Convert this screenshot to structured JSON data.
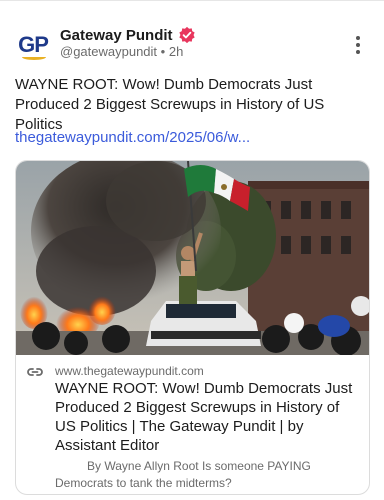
{
  "post": {
    "author_name": "Gateway Pundit",
    "handle": "@gatewaypundit",
    "separator": "•",
    "time": "2h",
    "avatar_initials": "GP",
    "verified_color": "#e8365d",
    "text": "WAYNE ROOT: Wow! Dumb Democrats Just Produced 2 Biggest Screwups in History of US Politics",
    "link_text": "thegatewaypundit.com/2025/06/w..."
  },
  "card": {
    "domain": "www.thegatewaypundit.com",
    "title": "WAYNE ROOT: Wow! Dumb Democrats Just Produced 2 Biggest Screwups in History of US Politics | The Gateway Pundit | by Assistant Editor",
    "description": "By Wayne Allyn Root Is someone PAYING Democrats to tank the midterms?",
    "image_icon": "protest-photo",
    "link_icon": "link-icon"
  },
  "colors": {
    "link": "#3b5bdb",
    "brand_blue": "#1f3a8a",
    "brand_gold": "#e9b124"
  }
}
